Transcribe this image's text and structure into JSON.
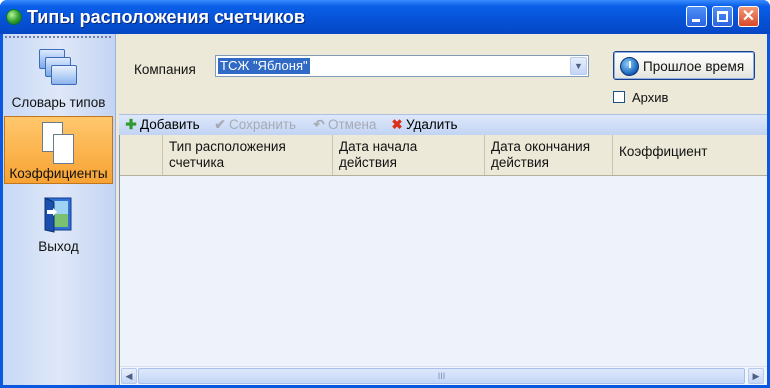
{
  "window": {
    "title": "Типы расположения счетчиков",
    "controls": {
      "minimize": "minimize-icon",
      "maximize": "maximize-icon",
      "close": "✕"
    }
  },
  "sidebar": {
    "items": [
      {
        "label": "Словарь типов",
        "icon": "dictionary-folders-icon",
        "active": false
      },
      {
        "label": "Коэффициенты",
        "icon": "documents-icon",
        "active": true
      },
      {
        "label": "Выход",
        "icon": "exit-door-icon",
        "active": false
      }
    ]
  },
  "form": {
    "company_label": "Компания",
    "company_value": "ТСЖ \"Яблоня\"",
    "past_time_button": "Прошлое время",
    "archive_label": "Архив",
    "archive_checked": false
  },
  "toolbar": {
    "add": "Добавить",
    "save": "Сохранить",
    "cancel": "Отмена",
    "delete": "Удалить"
  },
  "grid": {
    "columns": [
      {
        "line1": "Тип расположения",
        "line2": "счетчика"
      },
      {
        "line1": "Дата начала",
        "line2": "действия"
      },
      {
        "line1": "Дата окончания",
        "line2": "действия"
      },
      {
        "line1": "Коэффициент",
        "line2": ""
      }
    ],
    "rows": [],
    "scroll_grip": "III"
  },
  "colors": {
    "titlebar": "#0651d6",
    "active_item": "#f8a334",
    "selection": "#316ac5",
    "grid_bg": "#eef3fb"
  }
}
